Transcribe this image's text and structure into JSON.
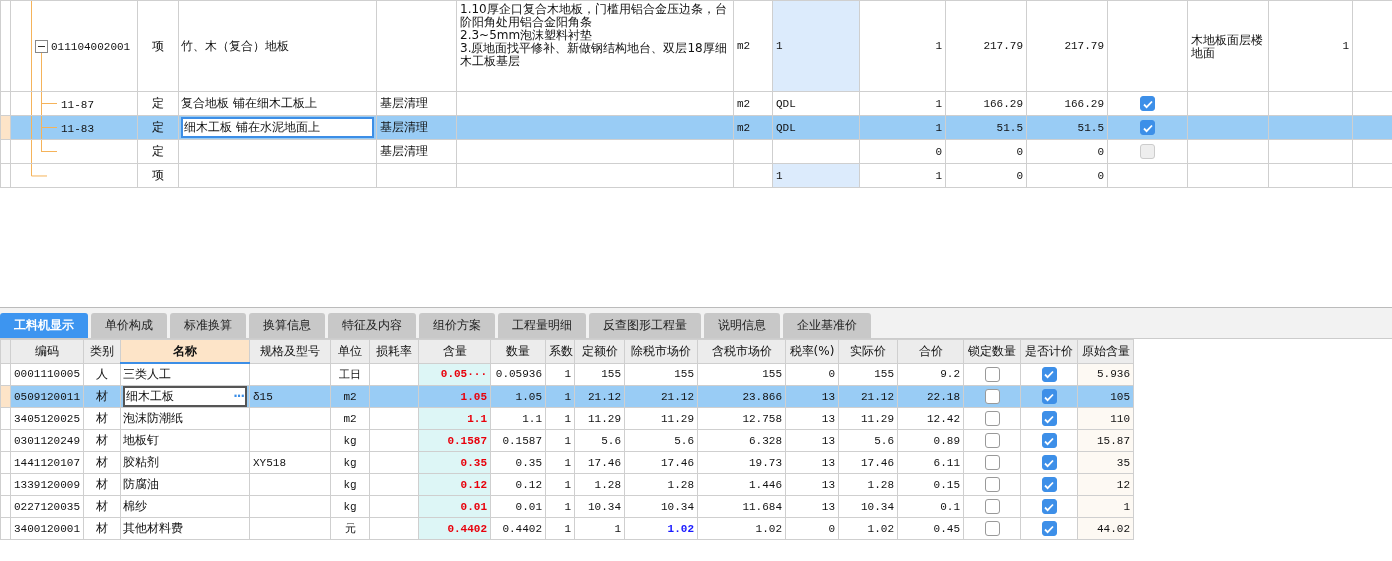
{
  "top_table": {
    "rows": [
      {
        "kind": "item",
        "selected": false,
        "expanded": true,
        "code": "011104002001",
        "type": "项",
        "name": "竹、木（复合）地板",
        "column_5": [
          "1.10厚企口复合木地板，门槛用铝合金压边条，台阶阳角处用铝合金阳角条",
          "2.3~5mm泡沫塑料衬垫",
          "3.原地面找平修补、新做钢结构地台、双层18厚细木工板基层"
        ],
        "column_6": "m2",
        "column_7": "1",
        "column_8": "1",
        "column_9": "217.79",
        "column_10": "217.79",
        "column_12": "木地板面层楼地面",
        "column_13": "1",
        "children": [
          {
            "kind": "quota",
            "selected": false,
            "code": "11-87",
            "type": "定",
            "name": "复合地板 铺在细木工板上",
            "column_4": "基层清理",
            "column_6": "m2",
            "column_7": "QDL",
            "column_8": "1",
            "column_9": "166.29",
            "column_10": "166.29",
            "checked": true,
            "disabled": false
          },
          {
            "kind": "quota",
            "selected": true,
            "code": "11-83",
            "type": "定",
            "name": "细木工板 铺在水泥地面上",
            "column_4": "基层清理",
            "column_6": "m2",
            "column_7": "QDL",
            "column_8": "1",
            "column_9": "51.5",
            "column_10": "51.5",
            "checked": true,
            "disabled": false
          },
          {
            "kind": "quota",
            "selected": false,
            "type": "定",
            "column_4": "基层清理",
            "column_8": "0",
            "column_9": "0",
            "column_10": "0",
            "checked": false,
            "disabled": true
          }
        ]
      },
      {
        "kind": "item",
        "selected": false,
        "type": "项",
        "column_7": "1",
        "column_8": "1",
        "column_9": "0",
        "column_10": "0",
        "children": []
      }
    ]
  },
  "tabs": [
    {
      "label": "工料机显示",
      "selected": true
    },
    {
      "label": "单价构成",
      "selected": false
    },
    {
      "label": "标准换算",
      "selected": false
    },
    {
      "label": "换算信息",
      "selected": false
    },
    {
      "label": "特征及内容",
      "selected": false
    },
    {
      "label": "组价方案",
      "selected": false
    },
    {
      "label": "工程量明细",
      "selected": false
    },
    {
      "label": "反查图形工程量",
      "selected": false
    },
    {
      "label": "说明信息",
      "selected": false
    },
    {
      "label": "企业基准价",
      "selected": false
    }
  ],
  "materials": {
    "columns": [
      "编码",
      "类别",
      "名称",
      "规格及型号",
      "单位",
      "损耗率",
      "含量",
      "数量",
      "系数",
      "定额价",
      "除税市场价",
      "含税市场价",
      "税率(%)",
      "实际价",
      "合价",
      "锁定数量",
      "是否计价",
      "原始含量"
    ],
    "rows": [
      {
        "selected": false,
        "code": "0001110005",
        "type": "人",
        "name": "三类人工",
        "unit": "工日",
        "content": "0.05···",
        "qty": "0.05936",
        "coef": "1",
        "quota": "155",
        "ex_tax": "155",
        "in_tax": "155",
        "rate": "0",
        "actual": "155",
        "total": "9.2",
        "locked": false,
        "checked": true,
        "original": "5.936",
        "ex_tax_edited": false
      },
      {
        "selected": true,
        "code": "0509120011",
        "type": "材",
        "name": "细木工板",
        "name_button": "···",
        "spec": "δ15",
        "unit": "m2",
        "content": "1.05",
        "qty": "1.05",
        "coef": "1",
        "quota": "21.12",
        "ex_tax": "21.12",
        "in_tax": "23.866",
        "rate": "13",
        "actual": "21.12",
        "total": "22.18",
        "locked": false,
        "checked": true,
        "original": "105",
        "ex_tax_edited": false
      },
      {
        "selected": false,
        "code": "3405120025",
        "type": "材",
        "name": "泡沫防潮纸",
        "unit": "m2",
        "content": "1.1",
        "qty": "1.1",
        "coef": "1",
        "quota": "11.29",
        "ex_tax": "11.29",
        "in_tax": "12.758",
        "rate": "13",
        "actual": "11.29",
        "total": "12.42",
        "locked": false,
        "checked": true,
        "original": "110",
        "ex_tax_edited": false
      },
      {
        "selected": false,
        "code": "0301120249",
        "type": "材",
        "name": "地板钉",
        "unit": "kg",
        "content": "0.1587",
        "qty": "0.1587",
        "coef": "1",
        "quota": "5.6",
        "ex_tax": "5.6",
        "in_tax": "6.328",
        "rate": "13",
        "actual": "5.6",
        "total": "0.89",
        "locked": false,
        "checked": true,
        "original": "15.87",
        "ex_tax_edited": false
      },
      {
        "selected": false,
        "code": "1441120107",
        "type": "材",
        "name": "胶粘剂",
        "spec": "XY518",
        "unit": "kg",
        "content": "0.35",
        "qty": "0.35",
        "coef": "1",
        "quota": "17.46",
        "ex_tax": "17.46",
        "in_tax": "19.73",
        "rate": "13",
        "actual": "17.46",
        "total": "6.11",
        "locked": false,
        "checked": true,
        "original": "35",
        "ex_tax_edited": false
      },
      {
        "selected": false,
        "code": "1339120009",
        "type": "材",
        "name": "防腐油",
        "unit": "kg",
        "content": "0.12",
        "qty": "0.12",
        "coef": "1",
        "quota": "1.28",
        "ex_tax": "1.28",
        "in_tax": "1.446",
        "rate": "13",
        "actual": "1.28",
        "total": "0.15",
        "locked": false,
        "checked": true,
        "original": "12",
        "ex_tax_edited": false
      },
      {
        "selected": false,
        "code": "0227120035",
        "type": "材",
        "name": "棉纱",
        "unit": "kg",
        "content": "0.01",
        "qty": "0.01",
        "coef": "1",
        "quota": "10.34",
        "ex_tax": "10.34",
        "in_tax": "11.684",
        "rate": "13",
        "actual": "10.34",
        "total": "0.1",
        "locked": false,
        "checked": true,
        "original": "1",
        "ex_tax_edited": false
      },
      {
        "selected": false,
        "code": "3400120001",
        "type": "材",
        "name": "其他材料费",
        "unit": "元",
        "content": "0.4402",
        "qty": "0.4402",
        "coef": "1",
        "quota": "1",
        "ex_tax": "1.02",
        "in_tax": "1.02",
        "rate": "0",
        "actual": "1.02",
        "total": "0.45",
        "locked": false,
        "checked": true,
        "original": "44.02",
        "ex_tax_edited": true
      }
    ]
  }
}
